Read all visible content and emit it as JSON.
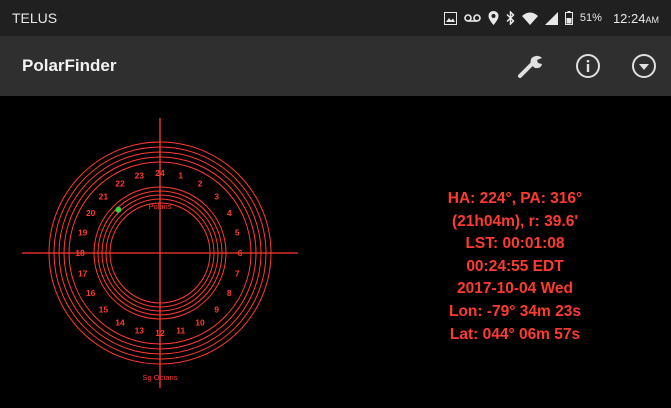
{
  "status_bar": {
    "carrier": "TELUS",
    "battery": "51%",
    "time": "12:24",
    "time_suffix": "AM",
    "icons": [
      "image-icon",
      "voicemail-icon",
      "location-icon",
      "bluetooth-icon",
      "wifi-icon",
      "signal-icon",
      "battery-icon"
    ]
  },
  "app_bar": {
    "title": "PolarFinder",
    "actions": [
      "wrench-icon",
      "info-icon",
      "dropdown-icon"
    ]
  },
  "reticle": {
    "hour_labels": [
      "24",
      "1",
      "2",
      "3",
      "4",
      "5",
      "6",
      "7",
      "8",
      "9",
      "10",
      "11",
      "12",
      "13",
      "14",
      "15",
      "16",
      "17",
      "18",
      "19",
      "20",
      "21",
      "22",
      "23"
    ],
    "polaris_label": "Polaris",
    "sigma_octans_label": "Sg Octans",
    "polaris_hour_angle_h": 21.07,
    "color": "#ff3b30",
    "marker_color": "#3cd13c"
  },
  "info": {
    "ha_pa": "HA: 224°, PA: 316°",
    "hour_r": "(21h04m), r: 39.6'",
    "lst": "LST: 00:01:08",
    "time": "00:24:55 EDT",
    "date": "2017-10-04 Wed",
    "lon": "Lon: -79° 34m 23s",
    "lat": "Lat: 044° 06m 57s",
    "color": "#ff3b30"
  }
}
